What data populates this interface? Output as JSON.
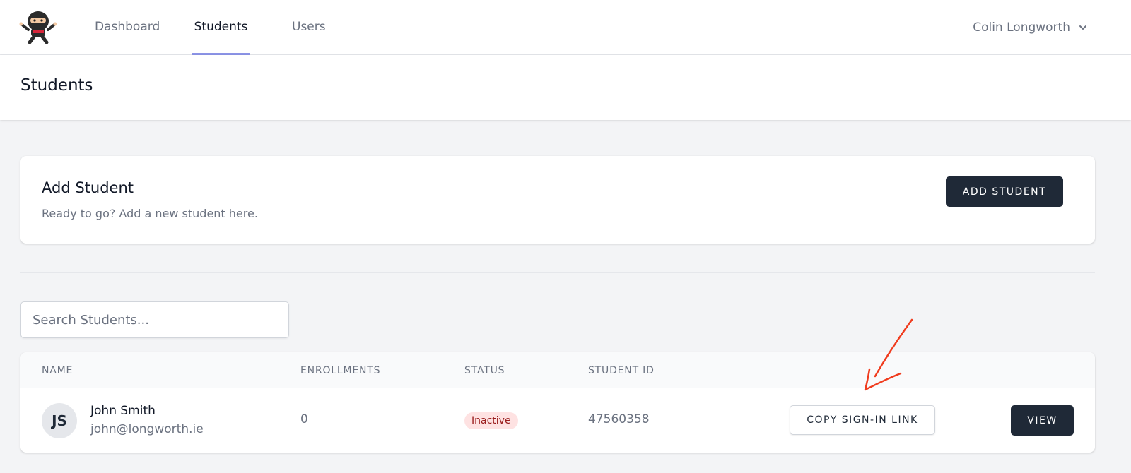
{
  "nav": {
    "links": [
      "Dashboard",
      "Students",
      "Users"
    ],
    "active": "Students",
    "user_name": "Colin Longworth"
  },
  "page": {
    "title": "Students"
  },
  "add_card": {
    "title": "Add Student",
    "description": "Ready to go? Add a new student here.",
    "button_label": "ADD STUDENT"
  },
  "search": {
    "placeholder": "Search Students..."
  },
  "table": {
    "headers": [
      "NAME",
      "ENROLLMENTS",
      "STATUS",
      "STUDENT ID"
    ],
    "rows": [
      {
        "initials": "JS",
        "name": "John Smith",
        "email": "john@longworth.ie",
        "enrollments": "0",
        "status": "Inactive",
        "student_id": "47560358",
        "copy_label": "COPY SIGN-IN LINK",
        "view_label": "VIEW"
      }
    ]
  },
  "colors": {
    "accent": "#8b93e6",
    "button_dark": "#1f2937",
    "annotation": "#f03c1e",
    "inactive_bg": "#fee2e2",
    "inactive_text": "#991b1b"
  },
  "icons": [
    "ninja-logo-icon",
    "chevron-down-icon",
    "arrow-annotation-icon"
  ]
}
